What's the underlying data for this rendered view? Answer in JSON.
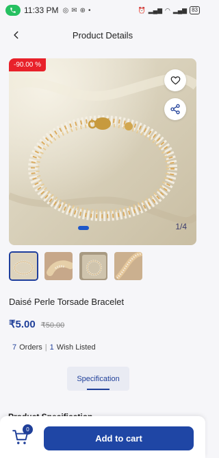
{
  "status_bar": {
    "time": "11:33 PM",
    "battery": "83"
  },
  "header": {
    "title": "Product Details"
  },
  "gallery": {
    "discount": "-90.00 %",
    "counter": "1/4"
  },
  "product": {
    "name": "Daisé Perle Torsade Bracelet",
    "price": "₹5.00",
    "mrp": "₹50.00"
  },
  "stats": {
    "orders_count": "7",
    "orders_label": "Orders",
    "separator": "|",
    "wish_count": "1",
    "wish_label": "Wish Listed"
  },
  "tabs": {
    "specification": "Specification"
  },
  "sections": {
    "spec_heading": "Product Specification"
  },
  "bottom": {
    "cart_count": "0",
    "add_to_cart": "Add to cart"
  },
  "colors": {
    "primary": "#1f46a5",
    "discount": "#e8212a"
  }
}
